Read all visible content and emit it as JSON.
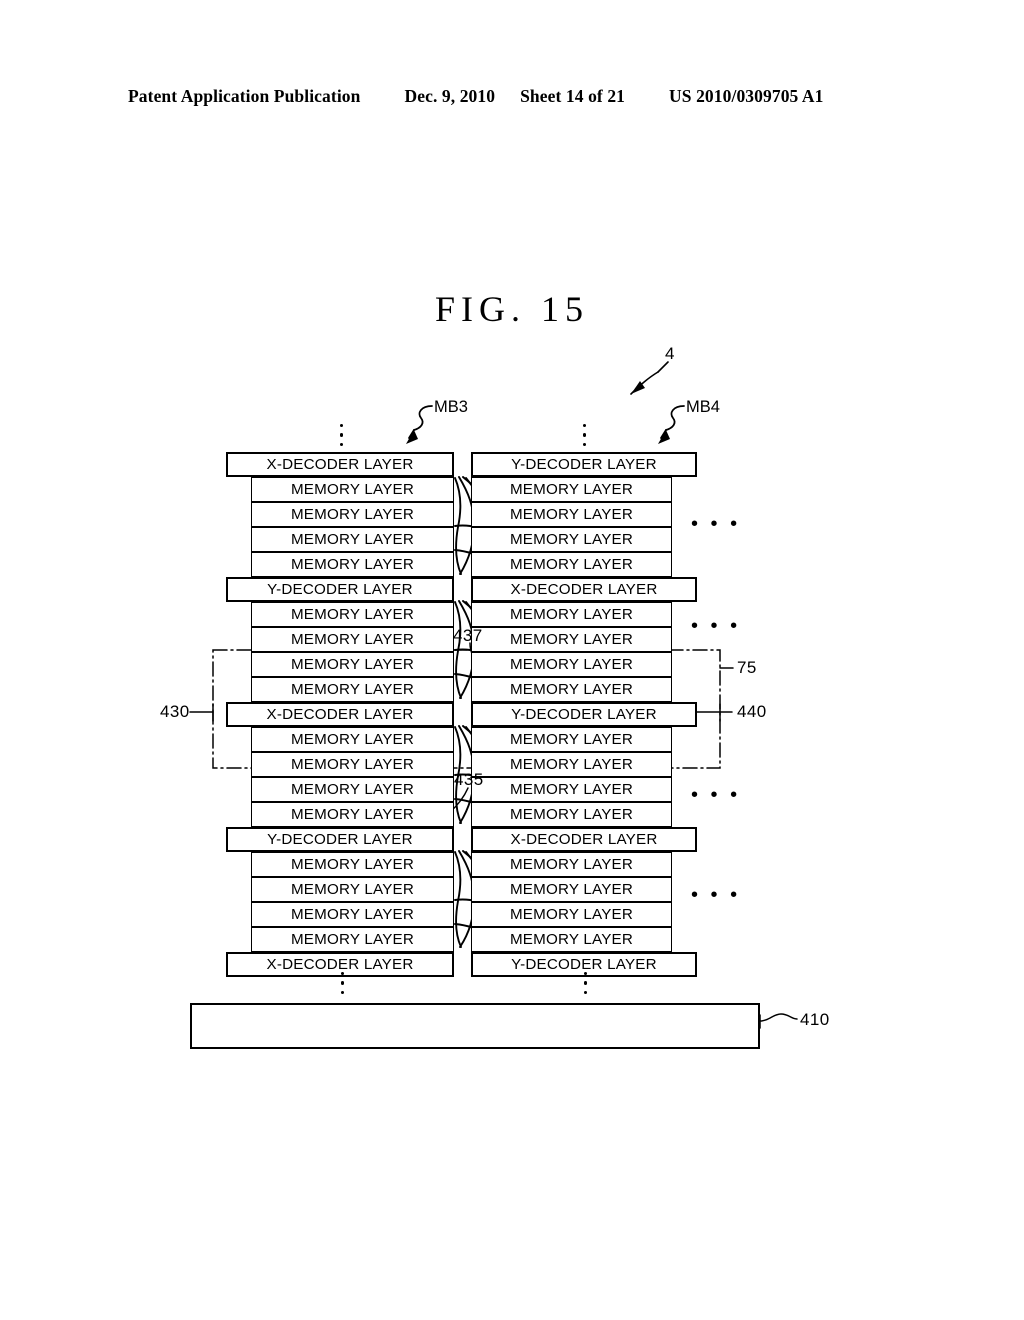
{
  "header": {
    "title": "Patent Application Publication",
    "date": "Dec. 9, 2010",
    "sheet": "Sheet 14 of 21",
    "patent_number": "US 2010/0309705 A1"
  },
  "figure": {
    "title": "FIG.  15",
    "device_ref": "4",
    "block_labels": {
      "left": "MB3",
      "right": "MB4"
    },
    "substrate_ref": "410",
    "callouts": {
      "left_stack": "430",
      "right_stack": "440",
      "unit_group": "75",
      "upper_via": "437",
      "lower_via": "435"
    },
    "ellipsis_horizontal": "• • •",
    "labels": {
      "x_decoder": "X-DECODER LAYER",
      "y_decoder": "Y-DECODER LAYER",
      "memory": "MEMORY LAYER"
    },
    "left_stack_rows": [
      {
        "type": "decoder",
        "label": "X-DECODER LAYER"
      },
      {
        "type": "memory",
        "label": "MEMORY LAYER"
      },
      {
        "type": "memory",
        "label": "MEMORY LAYER"
      },
      {
        "type": "memory",
        "label": "MEMORY LAYER"
      },
      {
        "type": "memory",
        "label": "MEMORY LAYER"
      },
      {
        "type": "decoder",
        "label": "Y-DECODER LAYER"
      },
      {
        "type": "memory",
        "label": "MEMORY LAYER"
      },
      {
        "type": "memory",
        "label": "MEMORY LAYER"
      },
      {
        "type": "memory",
        "label": "MEMORY LAYER"
      },
      {
        "type": "memory",
        "label": "MEMORY LAYER"
      },
      {
        "type": "decoder",
        "label": "X-DECODER LAYER"
      },
      {
        "type": "memory",
        "label": "MEMORY LAYER"
      },
      {
        "type": "memory",
        "label": "MEMORY LAYER"
      },
      {
        "type": "memory",
        "label": "MEMORY LAYER"
      },
      {
        "type": "memory",
        "label": "MEMORY LAYER"
      },
      {
        "type": "decoder",
        "label": "Y-DECODER LAYER"
      },
      {
        "type": "memory",
        "label": "MEMORY LAYER"
      },
      {
        "type": "memory",
        "label": "MEMORY LAYER"
      },
      {
        "type": "memory",
        "label": "MEMORY LAYER"
      },
      {
        "type": "memory",
        "label": "MEMORY LAYER"
      },
      {
        "type": "decoder",
        "label": "X-DECODER LAYER"
      }
    ],
    "right_stack_rows": [
      {
        "type": "decoder",
        "label": "Y-DECODER LAYER"
      },
      {
        "type": "memory",
        "label": "MEMORY LAYER"
      },
      {
        "type": "memory",
        "label": "MEMORY LAYER"
      },
      {
        "type": "memory",
        "label": "MEMORY LAYER"
      },
      {
        "type": "memory",
        "label": "MEMORY LAYER"
      },
      {
        "type": "decoder",
        "label": "X-DECODER LAYER"
      },
      {
        "type": "memory",
        "label": "MEMORY LAYER"
      },
      {
        "type": "memory",
        "label": "MEMORY LAYER"
      },
      {
        "type": "memory",
        "label": "MEMORY LAYER"
      },
      {
        "type": "memory",
        "label": "MEMORY LAYER"
      },
      {
        "type": "decoder",
        "label": "Y-DECODER LAYER"
      },
      {
        "type": "memory",
        "label": "MEMORY LAYER"
      },
      {
        "type": "memory",
        "label": "MEMORY LAYER"
      },
      {
        "type": "memory",
        "label": "MEMORY LAYER"
      },
      {
        "type": "memory",
        "label": "MEMORY LAYER"
      },
      {
        "type": "decoder",
        "label": "X-DECODER LAYER"
      },
      {
        "type": "memory",
        "label": "MEMORY LAYER"
      },
      {
        "type": "memory",
        "label": "MEMORY LAYER"
      },
      {
        "type": "memory",
        "label": "MEMORY LAYER"
      },
      {
        "type": "memory",
        "label": "MEMORY LAYER"
      },
      {
        "type": "decoder",
        "label": "Y-DECODER LAYER"
      }
    ]
  }
}
